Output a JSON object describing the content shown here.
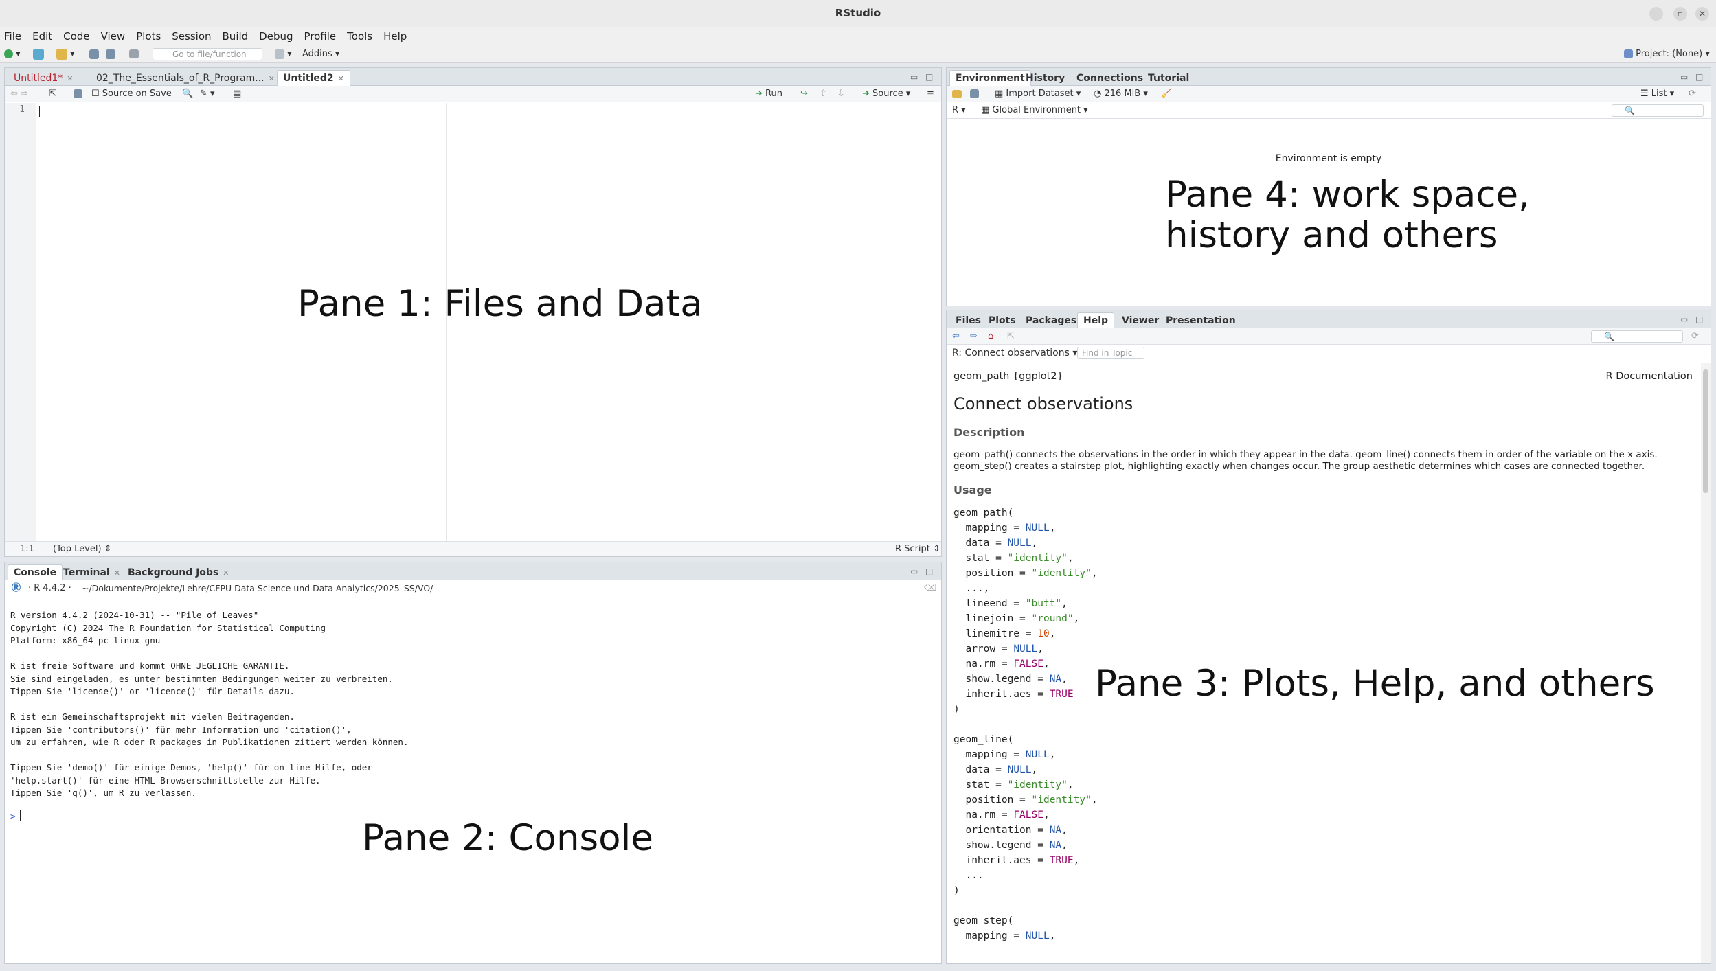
{
  "window": {
    "title": "RStudio"
  },
  "menu": [
    "File",
    "Edit",
    "Code",
    "View",
    "Plots",
    "Session",
    "Build",
    "Debug",
    "Profile",
    "Tools",
    "Help"
  ],
  "toolbar": {
    "goto_placeholder": "Go to file/function",
    "addins": "Addins",
    "project": "Project: (None)"
  },
  "editor": {
    "tabs": [
      "Untitled1*",
      "02_The_Essentials_of_R_Program...",
      "Untitled2"
    ],
    "source_on_save": "Source on Save",
    "run": "Run",
    "source": "Source",
    "line_number": "1",
    "status_pos": "1:1",
    "status_scope": "(Top Level)",
    "status_type": "R Script",
    "pane_label": "Pane 1: Files and Data"
  },
  "console": {
    "tabs": [
      "Console",
      "Terminal",
      "Background Jobs"
    ],
    "r_version": "R 4.4.2",
    "path": "~/Dokumente/Projekte/Lehre/CFPU Data Science und Data Analytics/2025_SS/VO/",
    "lines": [
      "R version 4.4.2 (2024-10-31) -- \"Pile of Leaves\"",
      "Copyright (C) 2024 The R Foundation for Statistical Computing",
      "Platform: x86_64-pc-linux-gnu",
      "",
      "R ist freie Software und kommt OHNE JEGLICHE GARANTIE.",
      "Sie sind eingeladen, es unter bestimmten Bedingungen weiter zu verbreiten.",
      "Tippen Sie 'license()' or 'licence()' für Details dazu.",
      "",
      "R ist ein Gemeinschaftsprojekt mit vielen Beitragenden.",
      "Tippen Sie 'contributors()' für mehr Information und 'citation()',",
      "um zu erfahren, wie R oder R packages in Publikationen zitiert werden können.",
      "",
      "Tippen Sie 'demo()' für einige Demos, 'help()' für on-line Hilfe, oder",
      "'help.start()' für eine HTML Browserschnittstelle zur Hilfe.",
      "Tippen Sie 'q()', um R zu verlassen."
    ],
    "prompt": ">",
    "pane_label": "Pane 2: Console"
  },
  "environment": {
    "tabs": [
      "Environment",
      "History",
      "Connections",
      "Tutorial"
    ],
    "import_dataset": "Import Dataset",
    "memory": "216 MiB",
    "view_mode": "List",
    "language": "R",
    "scope": "Global Environment",
    "empty_msg": "Environment is empty",
    "pane_label_line1": "Pane 4: work space,",
    "pane_label_line2": "history and others"
  },
  "help": {
    "tabs": [
      "Files",
      "Plots",
      "Packages",
      "Help",
      "Viewer",
      "Presentation"
    ],
    "topic": "R: Connect observations",
    "find_placeholder": "Find in Topic",
    "header_left": "geom_path {ggplot2}",
    "header_right": "R Documentation",
    "title": "Connect observations",
    "description_heading": "Description",
    "desc_line1": "geom_path() connects the observations in the order in which they appear in the data. geom_line() connects them in order of the variable on the x axis.",
    "desc_line2": "geom_step() creates a stairstep plot, highlighting exactly when changes occur. The group aesthetic determines which cases are connected together.",
    "usage_heading": "Usage",
    "code": [
      "geom_path(",
      "  mapping = NULL,",
      "  data = NULL,",
      "  stat = \"identity\",",
      "  position = \"identity\",",
      "  ...,",
      "  lineend = \"butt\",",
      "  linejoin = \"round\",",
      "  linemitre = 10,",
      "  arrow = NULL,",
      "  na.rm = FALSE,",
      "  show.legend = NA,",
      "  inherit.aes = TRUE",
      ")",
      "",
      "geom_line(",
      "  mapping = NULL,",
      "  data = NULL,",
      "  stat = \"identity\",",
      "  position = \"identity\",",
      "  na.rm = FALSE,",
      "  orientation = NA,",
      "  show.legend = NA,",
      "  inherit.aes = TRUE,",
      "  ...",
      ")",
      "",
      "geom_step(",
      "  mapping = NULL,"
    ],
    "pane_label": "Pane 3: Plots, Help, and others"
  }
}
